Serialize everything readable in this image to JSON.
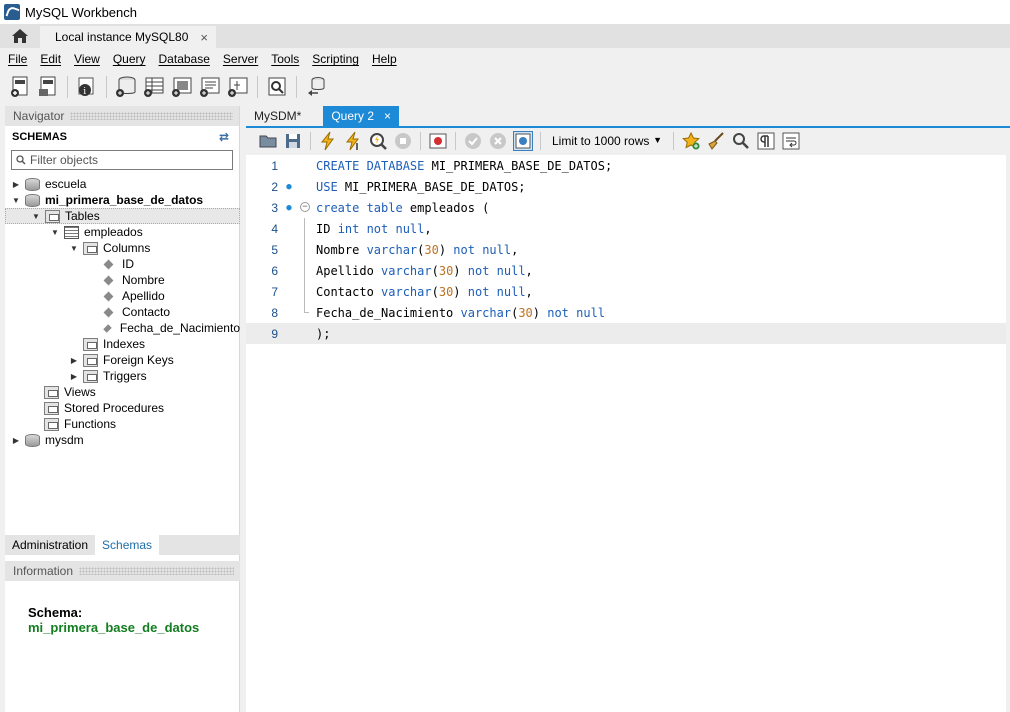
{
  "window": {
    "title": "MySQL Workbench",
    "icon": "mysql-workbench-logo"
  },
  "connection_tabs": [
    {
      "label": "Local instance MySQL80",
      "close": "×"
    }
  ],
  "menu": [
    "File",
    "Edit",
    "View",
    "Query",
    "Database",
    "Server",
    "Tools",
    "Scripting",
    "Help"
  ],
  "navigator": {
    "header": "Navigator",
    "schemas_title": "SCHEMAS",
    "filter_placeholder": "Filter objects",
    "tree": [
      {
        "label": "escuela",
        "level": 0,
        "toggle": "▶",
        "icon": "database",
        "bold": false
      },
      {
        "label": "mi_primera_base_de_datos",
        "level": 0,
        "toggle": "▼",
        "icon": "database",
        "bold": true
      },
      {
        "label": "Tables",
        "level": 1,
        "toggle": "▼",
        "icon": "folder",
        "selected": true
      },
      {
        "label": "empleados",
        "level": 2,
        "toggle": "▼",
        "icon": "table"
      },
      {
        "label": "Columns",
        "level": 3,
        "toggle": "▼",
        "icon": "folder"
      },
      {
        "label": "ID",
        "level": 4,
        "icon": "column"
      },
      {
        "label": "Nombre",
        "level": 4,
        "icon": "column"
      },
      {
        "label": "Apellido",
        "level": 4,
        "icon": "column"
      },
      {
        "label": "Contacto",
        "level": 4,
        "icon": "column"
      },
      {
        "label": "Fecha_de_Nacimiento",
        "level": 4,
        "icon": "column"
      },
      {
        "label": "Indexes",
        "level": 3,
        "icon": "folder"
      },
      {
        "label": "Foreign Keys",
        "level": 3,
        "toggle": "▶",
        "icon": "folder"
      },
      {
        "label": "Triggers",
        "level": 3,
        "toggle": "▶",
        "icon": "folder"
      },
      {
        "label": "Views",
        "level": 1,
        "icon": "folder"
      },
      {
        "label": "Stored Procedures",
        "level": 1,
        "icon": "folder"
      },
      {
        "label": "Functions",
        "level": 1,
        "icon": "folder"
      },
      {
        "label": "mysdm",
        "level": 0,
        "toggle": "▶",
        "icon": "database"
      }
    ],
    "bottom_tabs": [
      {
        "label": "Administration",
        "active": false
      },
      {
        "label": "Schemas",
        "active": true
      }
    ]
  },
  "information": {
    "header": "Information",
    "schema_label": "Schema:",
    "schema_value": "mi_primera_base_de_datos"
  },
  "editor": {
    "tabs": [
      {
        "label": "MySDM*",
        "active": false
      },
      {
        "label": "Query 2",
        "active": true,
        "close": "×"
      }
    ],
    "limit_option": "Limit to 1000 rows",
    "lines": [
      {
        "n": "1",
        "marker": false,
        "fold": "",
        "tokens": [
          {
            "t": "CREATE DATABASE ",
            "k": "kw"
          },
          {
            "t": "MI_PRIMERA_BASE_DE_DATOS;",
            "k": ""
          }
        ]
      },
      {
        "n": "2",
        "marker": true,
        "fold": "",
        "tokens": [
          {
            "t": "USE ",
            "k": "kw"
          },
          {
            "t": "MI_PRIMERA_BASE_DE_DATOS;",
            "k": ""
          }
        ]
      },
      {
        "n": "3",
        "marker": true,
        "fold": "start",
        "tokens": [
          {
            "t": "create table ",
            "k": "kw"
          },
          {
            "t": "empleados (",
            "k": ""
          }
        ]
      },
      {
        "n": "4",
        "marker": false,
        "fold": "mid",
        "tokens": [
          {
            "t": "ID ",
            "k": ""
          },
          {
            "t": "int not null",
            "k": "kw"
          },
          {
            "t": ",",
            "k": ""
          }
        ]
      },
      {
        "n": "5",
        "marker": false,
        "fold": "mid",
        "tokens": [
          {
            "t": "Nombre ",
            "k": ""
          },
          {
            "t": "varchar",
            "k": "kw"
          },
          {
            "t": "(",
            "k": ""
          },
          {
            "t": "30",
            "k": "num"
          },
          {
            "t": ") ",
            "k": ""
          },
          {
            "t": "not null",
            "k": "kw"
          },
          {
            "t": ",",
            "k": ""
          }
        ]
      },
      {
        "n": "6",
        "marker": false,
        "fold": "mid",
        "tokens": [
          {
            "t": "Apellido ",
            "k": ""
          },
          {
            "t": "varchar",
            "k": "kw"
          },
          {
            "t": "(",
            "k": ""
          },
          {
            "t": "30",
            "k": "num"
          },
          {
            "t": ") ",
            "k": ""
          },
          {
            "t": "not null",
            "k": "kw"
          },
          {
            "t": ",",
            "k": ""
          }
        ]
      },
      {
        "n": "7",
        "marker": false,
        "fold": "mid",
        "tokens": [
          {
            "t": "Contacto ",
            "k": ""
          },
          {
            "t": "varchar",
            "k": "kw"
          },
          {
            "t": "(",
            "k": ""
          },
          {
            "t": "30",
            "k": "num"
          },
          {
            "t": ") ",
            "k": ""
          },
          {
            "t": "not null",
            "k": "kw"
          },
          {
            "t": ",",
            "k": ""
          }
        ]
      },
      {
        "n": "8",
        "marker": false,
        "fold": "end",
        "tokens": [
          {
            "t": "Fecha_de_Nacimiento ",
            "k": ""
          },
          {
            "t": "varchar",
            "k": "kw"
          },
          {
            "t": "(",
            "k": ""
          },
          {
            "t": "30",
            "k": "num"
          },
          {
            "t": ") ",
            "k": ""
          },
          {
            "t": "not null",
            "k": "kw"
          }
        ]
      },
      {
        "n": "9",
        "marker": false,
        "fold": "",
        "current": true,
        "tokens": [
          {
            "t": ");",
            "k": ""
          }
        ]
      }
    ]
  },
  "colors": {
    "accent": "#1c8ad6",
    "keyword": "#1d5eb8",
    "number": "#c0711e",
    "schema_value": "#137d1f"
  }
}
